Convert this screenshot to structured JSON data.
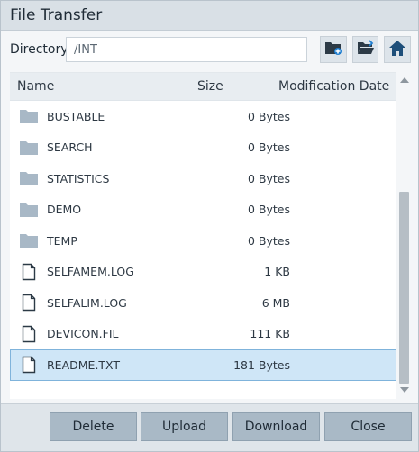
{
  "window": {
    "title": "File Transfer"
  },
  "directory": {
    "label": "Directory:",
    "value": "/INT"
  },
  "toolbar": {
    "icons": [
      "new-folder-icon",
      "open-folder-icon",
      "home-icon"
    ]
  },
  "table": {
    "columns": {
      "name": "Name",
      "size": "Size",
      "date": "Modification Date"
    },
    "rows": [
      {
        "type": "folder",
        "name": "BUSTABLE",
        "size": "0 Bytes",
        "date": ""
      },
      {
        "type": "folder",
        "name": "SEARCH",
        "size": "0 Bytes",
        "date": ""
      },
      {
        "type": "folder",
        "name": "STATISTICS",
        "size": "0 Bytes",
        "date": ""
      },
      {
        "type": "folder",
        "name": "DEMO",
        "size": "0 Bytes",
        "date": ""
      },
      {
        "type": "folder",
        "name": "TEMP",
        "size": "0 Bytes",
        "date": ""
      },
      {
        "type": "file",
        "name": "SELFAMEM.LOG",
        "size": "1 KB",
        "date": ""
      },
      {
        "type": "file",
        "name": "SELFALIM.LOG",
        "size": "6 MB",
        "date": ""
      },
      {
        "type": "file",
        "name": "DEVICON.FIL",
        "size": "111 KB",
        "date": ""
      },
      {
        "type": "file",
        "name": "README.TXT",
        "size": "181 Bytes",
        "date": "",
        "selected": true
      }
    ]
  },
  "buttons": {
    "delete": "Delete",
    "upload": "Upload",
    "download": "Download",
    "close": "Close"
  },
  "colors": {
    "selection": "#cfe6f7",
    "button": "#a9b9c6",
    "folder": "#a8b8c6"
  }
}
